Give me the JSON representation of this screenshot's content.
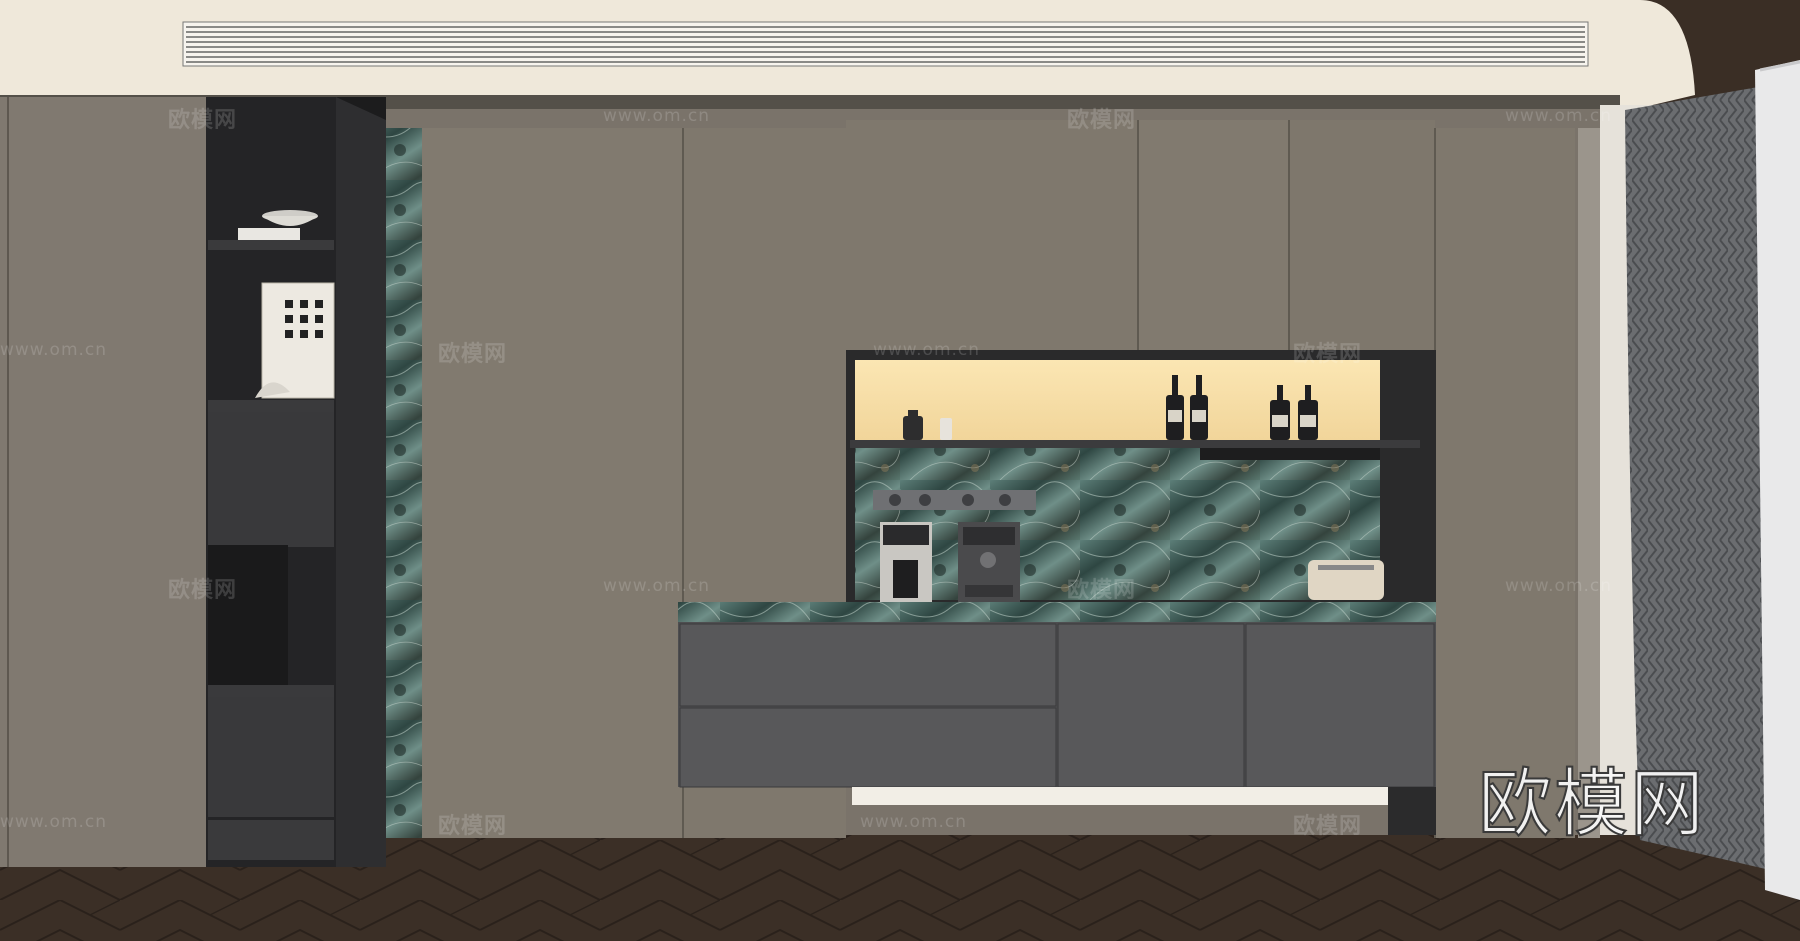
{
  "watermark": {
    "logo_text": "欧模网",
    "site_url": "www.om.cn"
  },
  "colors": {
    "ceiling": "#efe8da",
    "wall_panel": "#817a6f",
    "wall_panel_dark": "#736c62",
    "cabinet_dark": "#2b2b2c",
    "drawer_grey": "#58585a",
    "marble": "#3f5e5a",
    "niche_light": "#f6dfa8",
    "floor": "#3a2e25",
    "curtain": "#6a6c6f"
  },
  "icons": [
    "air-vent-icon",
    "bottle-icon",
    "coffee-machine-icon",
    "toaster-icon",
    "curtain-icon",
    "framed-art-icon",
    "bowl-icon"
  ]
}
